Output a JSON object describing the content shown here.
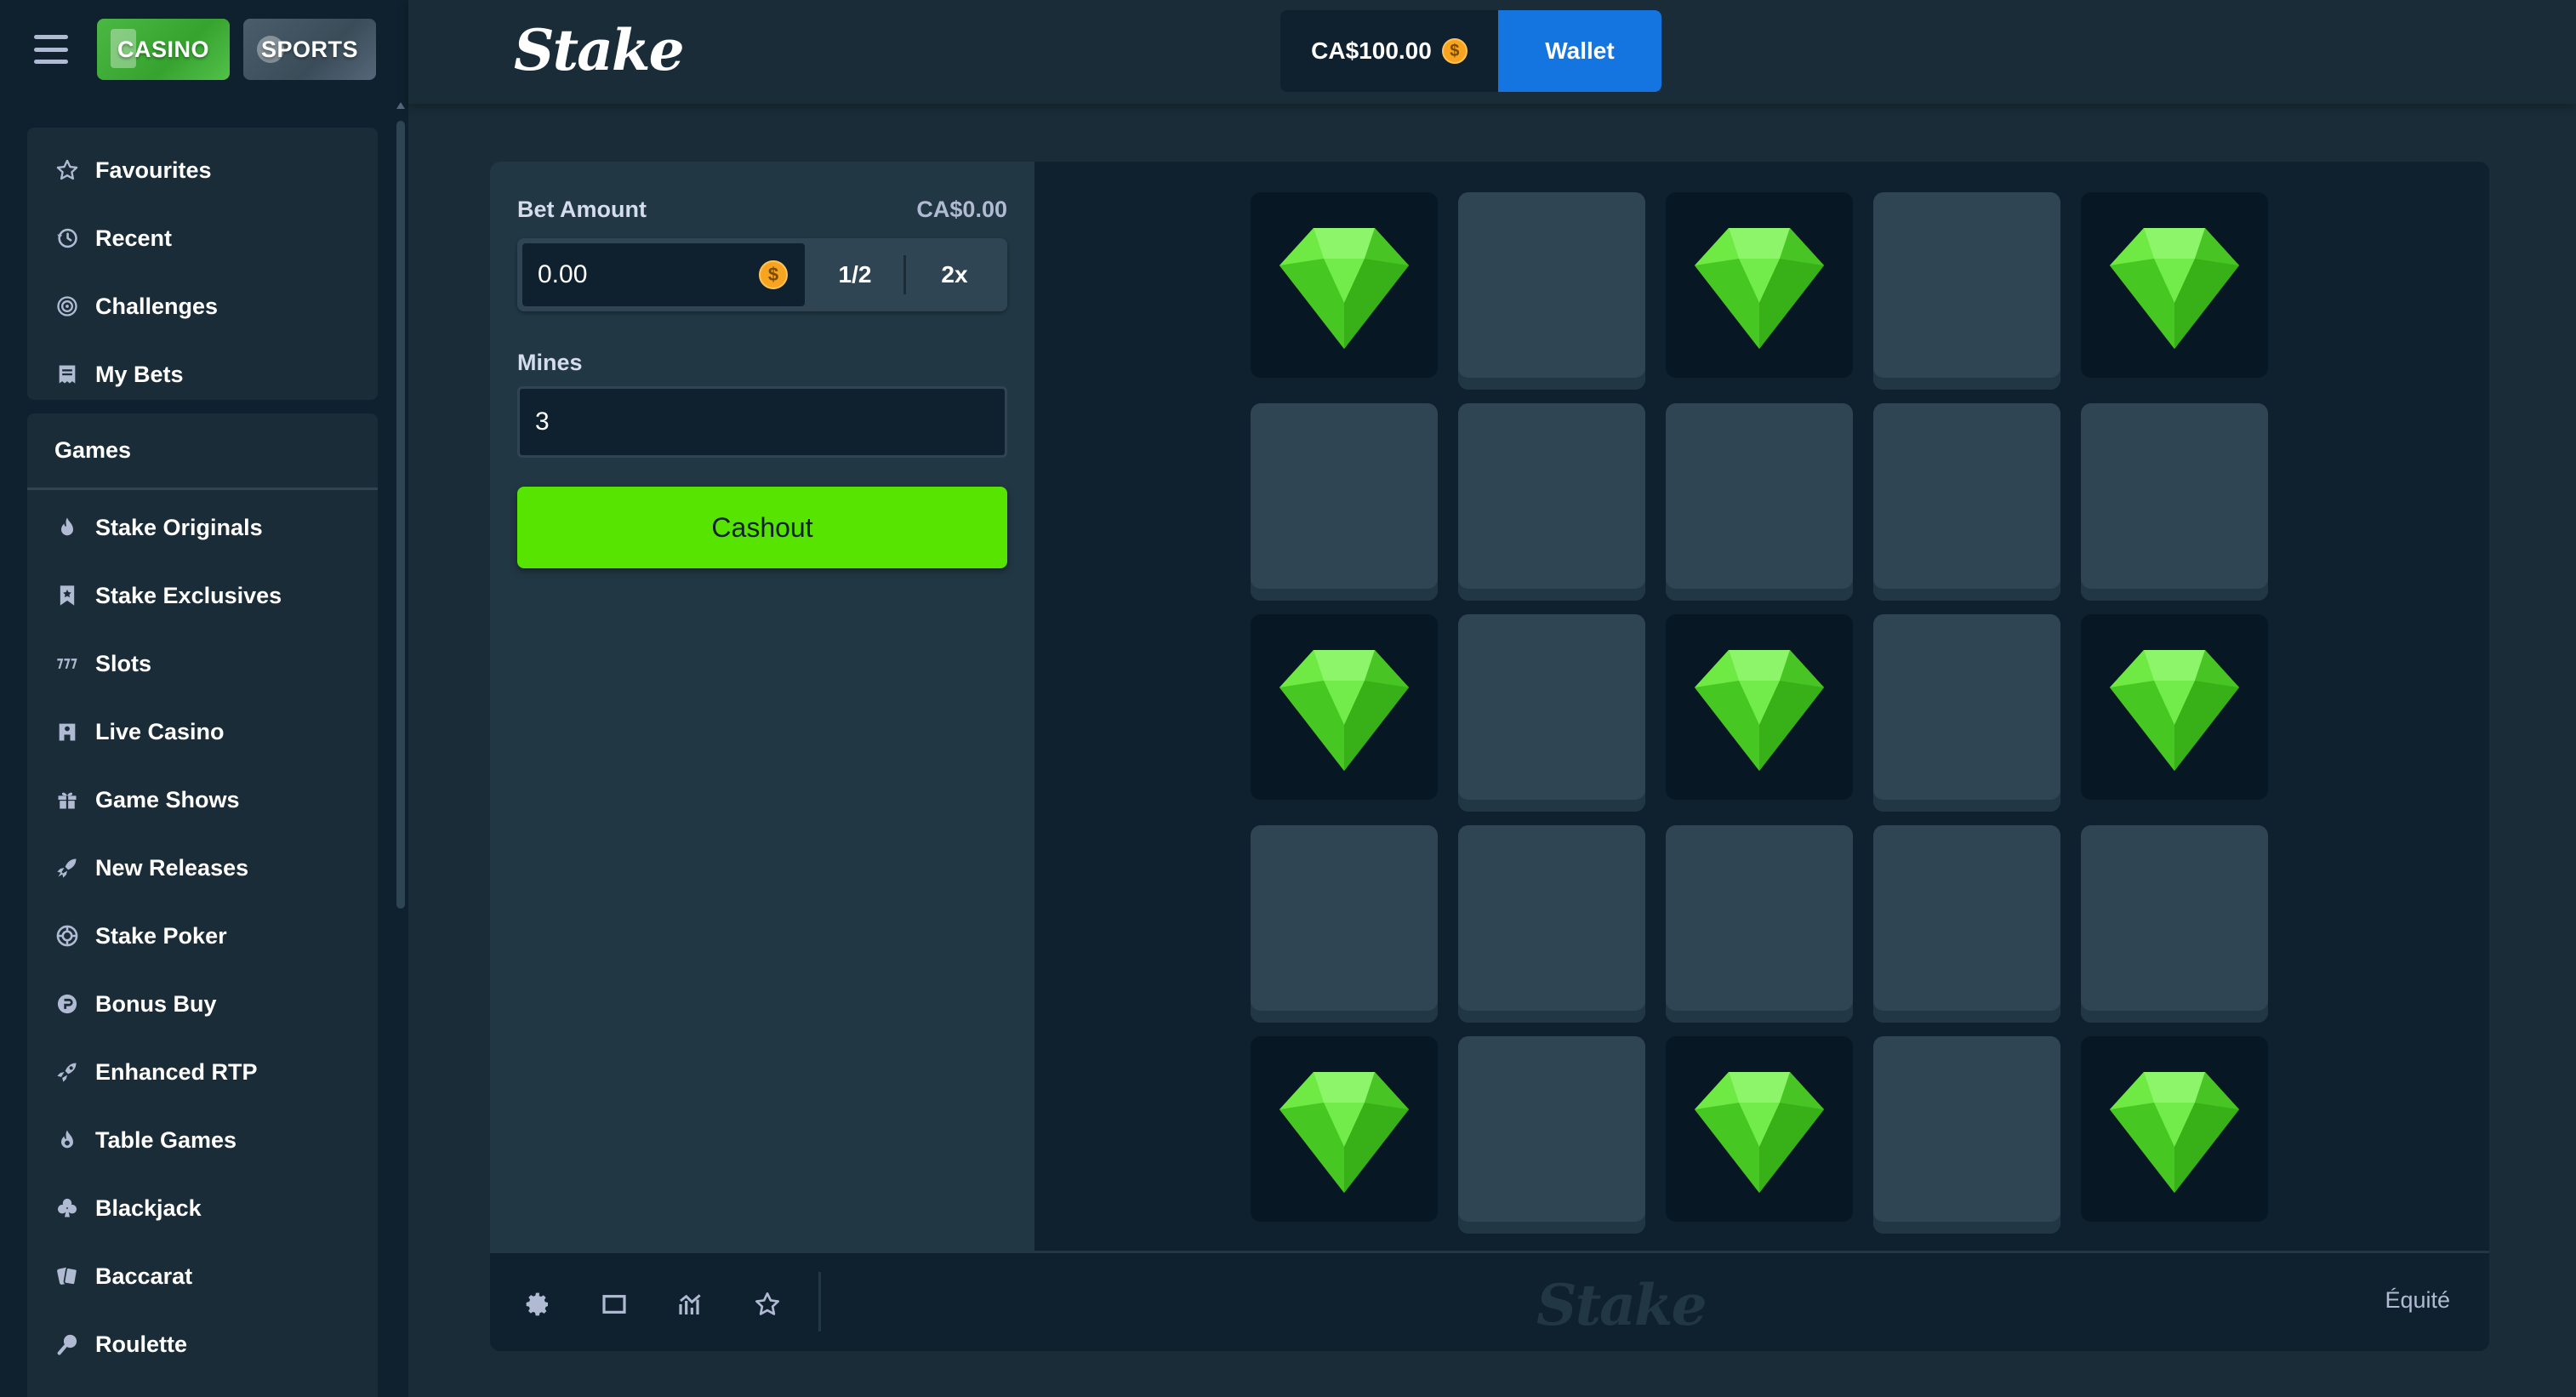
{
  "sidebar": {
    "tabs": {
      "casino": "CASINO",
      "sports": "SPORTS"
    },
    "top_items": [
      {
        "label": "Favourites",
        "icon": "star-icon"
      },
      {
        "label": "Recent",
        "icon": "history-icon"
      },
      {
        "label": "Challenges",
        "icon": "target-icon"
      },
      {
        "label": "My Bets",
        "icon": "receipt-icon"
      }
    ],
    "games_header": "Games",
    "game_items": [
      {
        "label": "Stake Originals",
        "icon": "flame-icon"
      },
      {
        "label": "Stake Exclusives",
        "icon": "bookmark-icon"
      },
      {
        "label": "Slots",
        "icon": "slots-icon"
      },
      {
        "label": "Live Casino",
        "icon": "live-dealer-icon"
      },
      {
        "label": "Game Shows",
        "icon": "gift-icon"
      },
      {
        "label": "New Releases",
        "icon": "rocket-icon"
      },
      {
        "label": "Stake Poker",
        "icon": "poker-chip-icon"
      },
      {
        "label": "Bonus Buy",
        "icon": "bonus-icon"
      },
      {
        "label": "Enhanced RTP",
        "icon": "enhanced-rocket-icon"
      },
      {
        "label": "Table Games",
        "icon": "table-flame-icon"
      },
      {
        "label": "Blackjack",
        "icon": "club-icon"
      },
      {
        "label": "Baccarat",
        "icon": "cards-icon"
      },
      {
        "label": "Roulette",
        "icon": "roulette-icon"
      }
    ]
  },
  "header": {
    "logo": "Stake",
    "balance": "CA$100.00",
    "currency_symbol": "$",
    "wallet_label": "Wallet"
  },
  "controls": {
    "bet_amount_label": "Bet Amount",
    "bet_amount_value_display": "CA$0.00",
    "bet_input_value": "0.00",
    "half_label": "1/2",
    "double_label": "2x",
    "mines_label": "Mines",
    "mines_value": "3",
    "cashout_label": "Cashout"
  },
  "board": {
    "rows": [
      [
        "gem",
        "hidden",
        "gem",
        "hidden",
        "gem"
      ],
      [
        "hidden",
        "hidden",
        "hidden",
        "hidden",
        "hidden"
      ],
      [
        "gem",
        "hidden",
        "gem",
        "hidden",
        "gem"
      ],
      [
        "hidden",
        "hidden",
        "hidden",
        "hidden",
        "hidden"
      ],
      [
        "gem",
        "hidden",
        "gem",
        "hidden",
        "gem"
      ]
    ]
  },
  "footer": {
    "logo": "Stake",
    "fairness_label": "Équité",
    "icons": [
      "gear-icon",
      "theatre-mode-icon",
      "stats-icon",
      "star-icon"
    ]
  },
  "colors": {
    "sidebar_bg": "#0f212e",
    "panel_bg": "#213743",
    "tile_hidden": "#2f4553",
    "cashout_green": "#57e400",
    "wallet_blue": "#1475e1",
    "gem_green": "#5de23c"
  }
}
